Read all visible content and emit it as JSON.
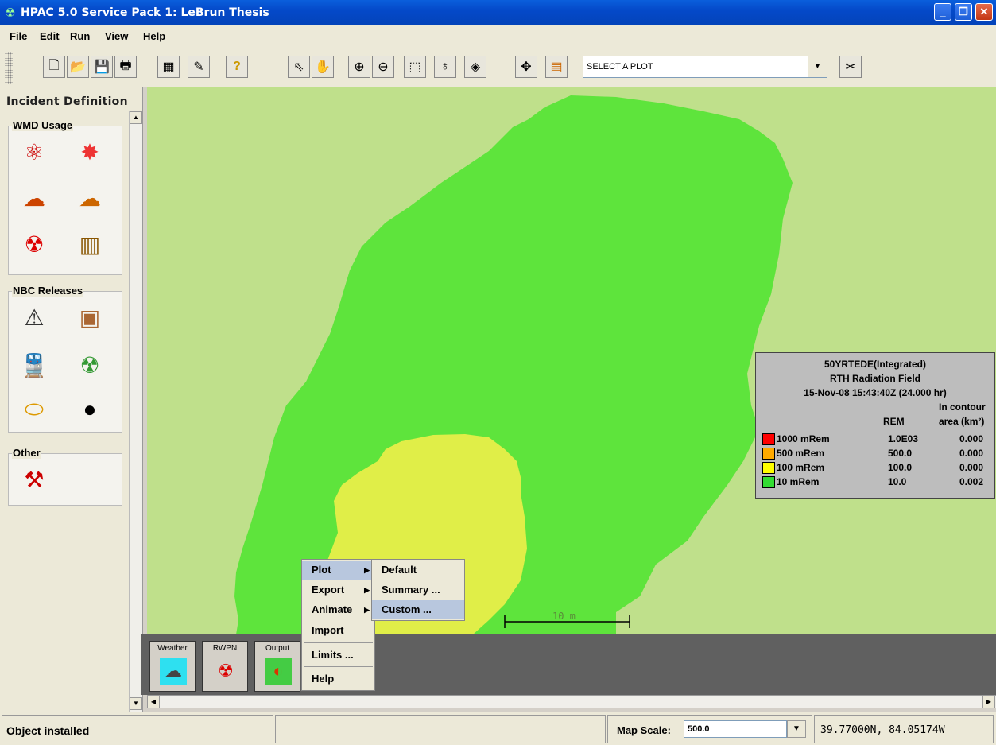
{
  "window": {
    "title": "HPAC 5.0 Service Pack 1: LeBrun Thesis",
    "controls": [
      "minimize",
      "restore",
      "close"
    ]
  },
  "menubar": {
    "items": [
      {
        "label": "File"
      },
      {
        "label": "Edit"
      },
      {
        "label": "Run"
      },
      {
        "label": "View"
      },
      {
        "label": "Help"
      }
    ]
  },
  "toolbar": {
    "buttons": [
      "new-file-icon",
      "open-folder-icon",
      "save-icon",
      "print-icon",
      "calculator-icon",
      "pen-tool-icon",
      "help-question-icon",
      "select-arrow-icon",
      "hand-pan-icon",
      "zoom-in-icon",
      "zoom-out-icon",
      "zoom-box-icon",
      "probe-icon",
      "globe-icon",
      "pan-arrows-icon",
      "layers-icon",
      "scissors-icon"
    ],
    "plot_select": {
      "value": "SELECT A PLOT"
    }
  },
  "left_panel": {
    "title": "Incident Definition",
    "groups": [
      {
        "label": "WMD Usage"
      },
      {
        "label": "NBC Releases"
      },
      {
        "label": "Other"
      }
    ]
  },
  "legend": {
    "title": "50YRTEDE(Integrated)",
    "subtitle": "RTH Radiation Field",
    "time": "15-Nov-08 15:43:40Z (24.000 hr)",
    "col_header_top": "In contour",
    "col_rem": "REM",
    "col_area": "area (km²)",
    "rows": [
      {
        "label": "1000 mRem",
        "rem": "1.0E03",
        "area": "0.000",
        "color": "#ff0000"
      },
      {
        "label": "500 mRem",
        "rem": "500.0",
        "area": "0.000",
        "color": "#ffaa00"
      },
      {
        "label": "100 mRem",
        "rem": "100.0",
        "area": "0.000",
        "color": "#ffff00"
      },
      {
        "label": "10 mRem",
        "rem": "10.0",
        "area": "0.002",
        "color": "#33dd33"
      }
    ]
  },
  "map": {
    "scale_bar_label": "10 m",
    "colors": {
      "background": "#bfe08b",
      "outer_contour": "#5ee43c",
      "inner_contour": "#e0ee48"
    }
  },
  "dock": {
    "buttons": [
      {
        "label": "Weather"
      },
      {
        "label": "RWPN"
      },
      {
        "label": "Output"
      }
    ]
  },
  "context_menu": {
    "items": [
      {
        "label": "Plot"
      },
      {
        "label": "Export"
      },
      {
        "label": "Animate"
      },
      {
        "label": "Import"
      },
      {
        "label": "Limits ..."
      },
      {
        "label": "Help"
      }
    ],
    "submenu": [
      {
        "label": "Default"
      },
      {
        "label": "Summary ..."
      },
      {
        "label": "Custom ..."
      }
    ]
  },
  "statusbar": {
    "status": "Object installed",
    "map_scale_label": "Map Scale:",
    "map_scale_value": "500.0",
    "coordinates": "39.77000N, 84.05174W"
  }
}
